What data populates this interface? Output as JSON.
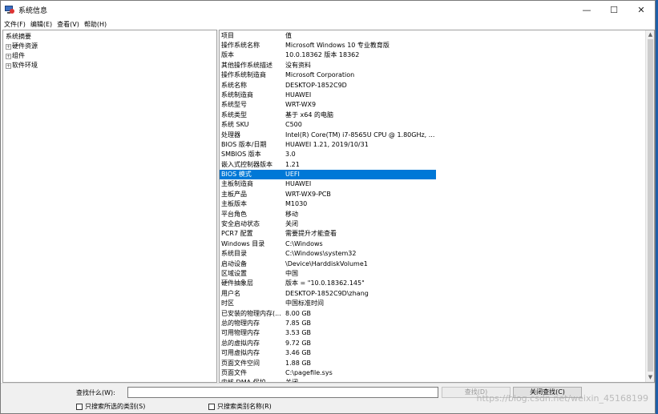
{
  "window": {
    "title": "系统信息",
    "controls": {
      "minimize": "—",
      "maximize": "☐",
      "close": "✕"
    }
  },
  "menu": [
    "文件(F)",
    "编辑(E)",
    "查看(V)",
    "帮助(H)"
  ],
  "tree": {
    "root": "系统摘要",
    "children": [
      "硬件资源",
      "组件",
      "软件环境"
    ]
  },
  "table": {
    "headers": {
      "item": "项目",
      "value": "值"
    },
    "rows": [
      [
        "操作系统名称",
        "Microsoft Windows 10 专业教育版"
      ],
      [
        "版本",
        "10.0.18362 版本 18362"
      ],
      [
        "其他操作系统描述",
        "没有资料"
      ],
      [
        "操作系统制造商",
        "Microsoft Corporation"
      ],
      [
        "系统名称",
        "DESKTOP-1852C9D"
      ],
      [
        "系统制造商",
        "HUAWEI"
      ],
      [
        "系统型号",
        "WRT-WX9"
      ],
      [
        "系统类型",
        "基于 x64 的电脑"
      ],
      [
        "系统 SKU",
        "C500"
      ],
      [
        "处理器",
        "Intel(R) Core(TM) i7-8565U CPU @ 1.80GHz, ..."
      ],
      [
        "BIOS 版本/日期",
        "HUAWEI 1.21, 2019/10/31"
      ],
      [
        "SMBIOS 版本",
        "3.0"
      ],
      [
        "嵌入式控制器版本",
        "1.21"
      ],
      [
        "BIOS 模式",
        "UEFI"
      ],
      [
        "主板制造商",
        "HUAWEI"
      ],
      [
        "主板产品",
        "WRT-WX9-PCB"
      ],
      [
        "主板版本",
        "M1030"
      ],
      [
        "平台角色",
        "移动"
      ],
      [
        "安全启动状态",
        "关闭"
      ],
      [
        "PCR7 配置",
        "需要提升才能查看"
      ],
      [
        "Windows 目录",
        "C:\\Windows"
      ],
      [
        "系统目录",
        "C:\\Windows\\system32"
      ],
      [
        "启动设备",
        "\\Device\\HarddiskVolume1"
      ],
      [
        "区域设置",
        "中国"
      ],
      [
        "硬件抽象层",
        "版本 = \"10.0.18362.145\""
      ],
      [
        "用户名",
        "DESKTOP-1852C9D\\zhang"
      ],
      [
        "时区",
        "中国标准时间"
      ],
      [
        "已安装的物理内存(...",
        "8.00 GB"
      ],
      [
        "总的物理内存",
        "7.85 GB"
      ],
      [
        "可用物理内存",
        "3.53 GB"
      ],
      [
        "总的虚拟内存",
        "9.72 GB"
      ],
      [
        "可用虚拟内存",
        "3.46 GB"
      ],
      [
        "页面文件空间",
        "1.88 GB"
      ],
      [
        "页面文件",
        "C:\\pagefile.sys"
      ],
      [
        "内核 DMA 保护",
        "关闭"
      ]
    ]
  },
  "search": {
    "label": "查找什么(W):",
    "value": "",
    "find_button": "查找(D)",
    "close_find_button": "关闭查找(C)",
    "chk_selected": "只搜索所选的类别(S)",
    "chk_names": "只搜索类别名称(R)"
  },
  "watermark": "https://blog.csdn.net/weixin_45168199"
}
